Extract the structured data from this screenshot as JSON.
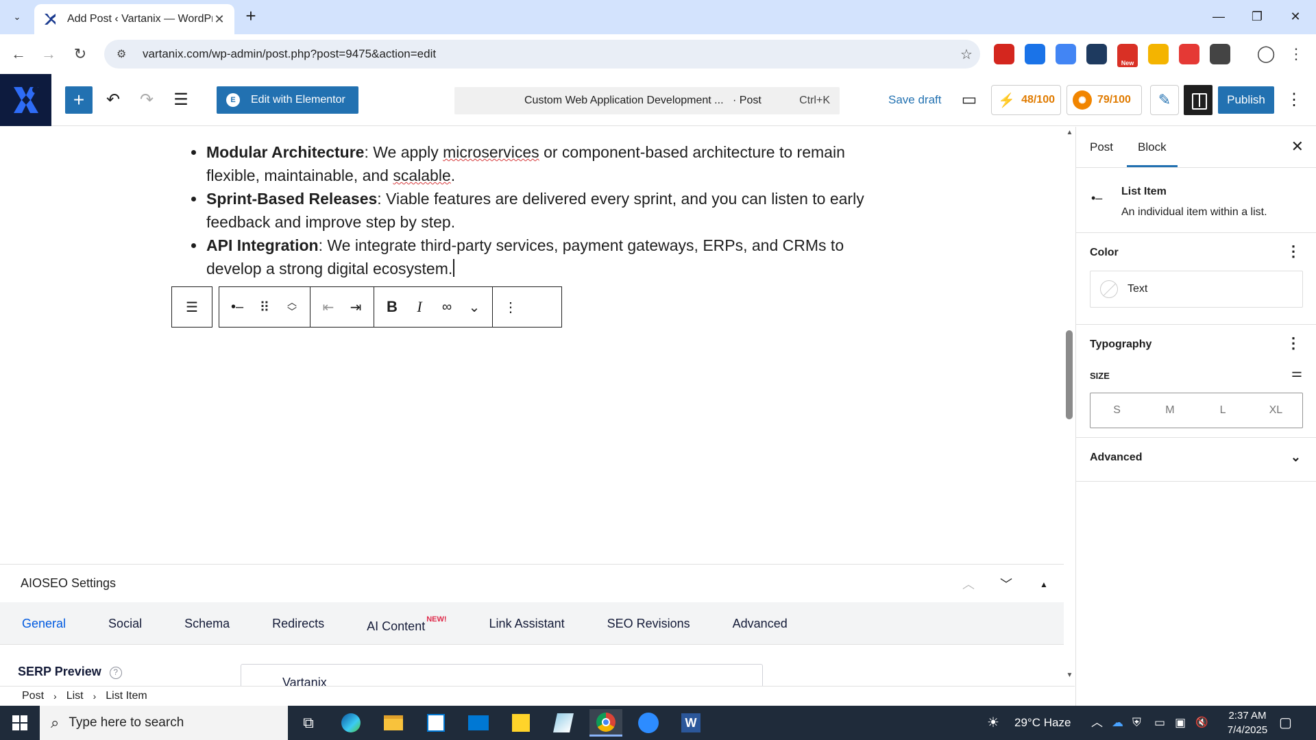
{
  "browser": {
    "tab_title": "Add Post ‹ Vartanix — WordPre",
    "url": "vartanix.com/wp-admin/post.php?post=9475&action=edit",
    "extensions": [
      {
        "name": "acrobat-icon",
        "color": "#d4261e"
      },
      {
        "name": "shield-icon",
        "color": "#1a73e8"
      },
      {
        "name": "document-icon",
        "color": "#4285f4"
      },
      {
        "name": "wallet-icon",
        "color": "#1e3a5f"
      },
      {
        "name": "new-extension-icon",
        "color": "#d93025",
        "badge": "New"
      },
      {
        "name": "coupon-icon",
        "color": "#f4b400"
      },
      {
        "name": "pokeball-icon",
        "color": "#e53935"
      },
      {
        "name": "puzzle-icon",
        "color": "#444444"
      }
    ]
  },
  "wp_header": {
    "elementor_label": "Edit with Elementor",
    "command_title": "Custom Web Application Development ...",
    "command_type": "· Post",
    "command_shortcut": "Ctrl+K",
    "save_draft": "Save draft",
    "score1": "48/100",
    "score2": "79/100",
    "publish": "Publish",
    "accent_color": "#2271b1"
  },
  "content": {
    "items": [
      {
        "bold": "Modular Architecture",
        "pre": ": We apply ",
        "sq1": "microservices",
        "mid": " or component-based architecture to remain flexible, maintainable, and ",
        "sq2": "scalable",
        "post": "."
      },
      {
        "bold": "Sprint-Based Releases",
        "text": ": Viable features are delivered every sprint, and you can listen to early feedback and improve step by step."
      },
      {
        "bold": "API Integration",
        "text": ": We integrate third-party services, payment gateways, ERPs, and CRMs to develop a strong digital ecosystem."
      }
    ]
  },
  "block_toolbar": {
    "buttons": [
      "list-parent-icon",
      "list-item-icon",
      "drag-handle-icon",
      "move-up-down-icon",
      "outdent-icon",
      "indent-icon",
      "bold-icon",
      "italic-icon",
      "link-icon",
      "more-rich-text-icon",
      "options-icon"
    ]
  },
  "aioseo": {
    "title": "AIOSEO Settings",
    "tabs": [
      "General",
      "Social",
      "Schema",
      "Redirects",
      "AI Content",
      "Link Assistant",
      "SEO Revisions",
      "Advanced"
    ],
    "new_badge": "NEW!",
    "serp_label": "SERP Preview",
    "serp_site": "Vartanix"
  },
  "breadcrumb": [
    "Post",
    "List",
    "List Item"
  ],
  "sidebar": {
    "tab_post": "Post",
    "tab_block": "Block",
    "block_name": "List Item",
    "block_desc": "An individual item within a list.",
    "color_title": "Color",
    "color_text": "Text",
    "typography_title": "Typography",
    "size_label": "SIZE",
    "sizes": [
      "S",
      "M",
      "L",
      "XL"
    ],
    "advanced_title": "Advanced"
  },
  "taskbar": {
    "search_placeholder": "Type here to search",
    "weather": "29°C  Haze",
    "time": "2:37 AM",
    "date": "7/4/2025"
  }
}
